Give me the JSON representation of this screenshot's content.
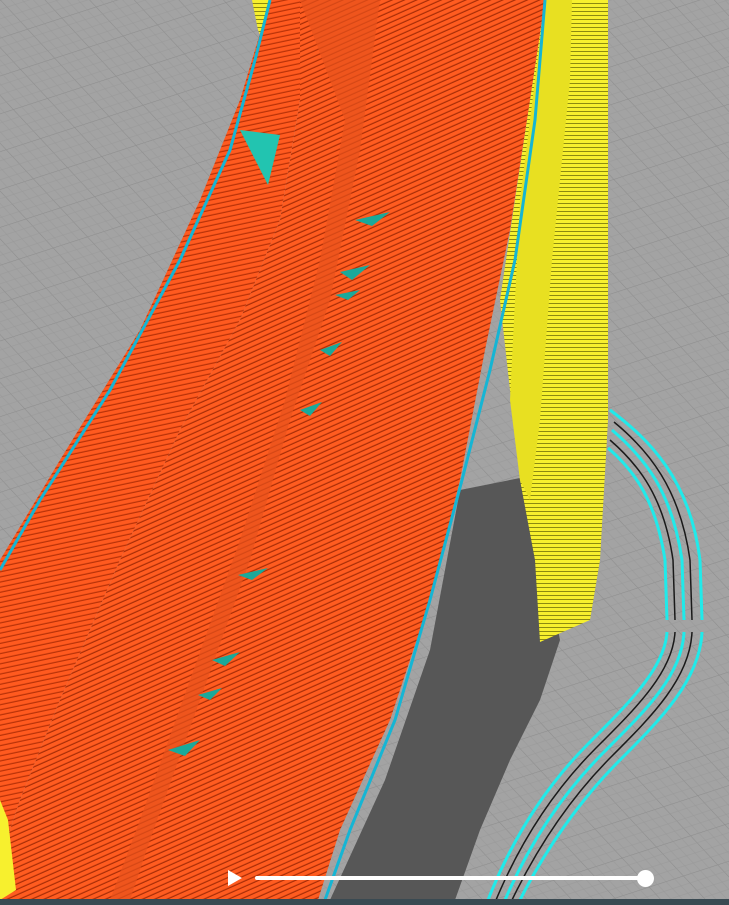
{
  "viewer": {
    "scene": "gcode-layer-preview",
    "colors": {
      "build_plate": "#9c9c9c",
      "grid_line": "#8a8a8a",
      "outer_wall": "#ff5a1f",
      "inner_wall": "#f5ef2c",
      "support": "#20e8e8",
      "skin_edge": "#15b5d4",
      "shadow": "#555555",
      "bottom_bar": "#3a4a52"
    },
    "icons": {
      "play": "play-icon"
    }
  },
  "playback": {
    "progress": 1.0
  }
}
